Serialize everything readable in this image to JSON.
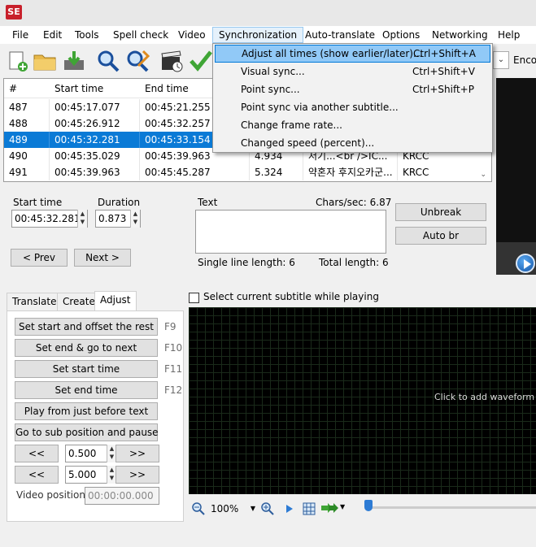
{
  "app": {
    "logo_text": "SE"
  },
  "menu": [
    {
      "label": "File"
    },
    {
      "label": "Edit"
    },
    {
      "label": "Tools"
    },
    {
      "label": "Spell check"
    },
    {
      "label": "Video"
    },
    {
      "label": "Synchronization"
    },
    {
      "label": "Auto-translate"
    },
    {
      "label": "Options"
    },
    {
      "label": "Networking"
    },
    {
      "label": "Help"
    }
  ],
  "toolbar": {
    "icons": [
      "new-file-icon",
      "open-folder-icon",
      "save-download-icon",
      "find-icon",
      "replace-icon",
      "video-clapper-icon",
      "checkmark-icon"
    ],
    "encoding_label": "Enco"
  },
  "sync_menu": {
    "items": [
      {
        "label": "Adjust all times (show earlier/later)...",
        "shortcut": "Ctrl+Shift+A"
      },
      {
        "label": "Visual sync...",
        "shortcut": "Ctrl+Shift+V"
      },
      {
        "label": "Point sync...",
        "shortcut": "Ctrl+Shift+P"
      },
      {
        "label": "Point sync via another subtitle...",
        "shortcut": ""
      },
      {
        "label": "Change frame rate...",
        "shortcut": ""
      },
      {
        "label": "Changed speed (percent)...",
        "shortcut": ""
      }
    ]
  },
  "grid": {
    "headers": {
      "num": "#",
      "start": "Start time",
      "end": "End time"
    },
    "rows": [
      {
        "num": "487",
        "start": "00:45:17.077",
        "end": "00:45:21.255",
        "duration": "",
        "text": "",
        "style": ""
      },
      {
        "num": "488",
        "start": "00:45:26.912",
        "end": "00:45:32.257",
        "duration": "",
        "text": "",
        "style": ""
      },
      {
        "num": "489",
        "start": "00:45:32.281",
        "end": "00:45:33.154",
        "duration": "",
        "text": "",
        "style": ""
      },
      {
        "num": "490",
        "start": "00:45:35.029",
        "end": "00:45:39.963",
        "duration": "4.934",
        "text": "저기...<br />IC...",
        "style": "KRCC"
      },
      {
        "num": "491",
        "start": "00:45:39.963",
        "end": "00:45:45.287",
        "duration": "5.324",
        "text": "약혼자 후지오카군...",
        "style": "KRCC"
      }
    ]
  },
  "edit": {
    "start_label": "Start time",
    "start_value": "00:45:32.281",
    "duration_label": "Duration",
    "duration_value": "0.873",
    "text_label": "Text",
    "chars_sec": "Chars/sec: 6.87",
    "single_line": "Single line length: 6",
    "total_length": "Total length: 6",
    "unbreak": "Unbreak",
    "auto_br": "Auto br",
    "prev": "< Prev",
    "next": "Next >"
  },
  "tabs": [
    {
      "label": "Translate"
    },
    {
      "label": "Create"
    },
    {
      "label": "Adjust"
    }
  ],
  "adjust": {
    "set_start_offset": "Set start and offset the rest",
    "set_start_offset_key": "F9",
    "set_end_next": "Set end & go to next",
    "set_end_next_key": "F10",
    "set_start": "Set start time",
    "set_start_key": "F11",
    "set_end": "Set end time",
    "set_end_key": "F12",
    "play_before": "Play from just before text",
    "goto_sub": "Go to sub position and pause",
    "back": "<<",
    "fwd": ">>",
    "step1": "0.500",
    "step2": "5.000",
    "video_pos_label": "Video position:",
    "video_pos_value": "00:00:00.000"
  },
  "waveform": {
    "checkbox_label": "Select current subtitle while playing",
    "hint": "Click to add waveform",
    "zoom": "100%"
  }
}
